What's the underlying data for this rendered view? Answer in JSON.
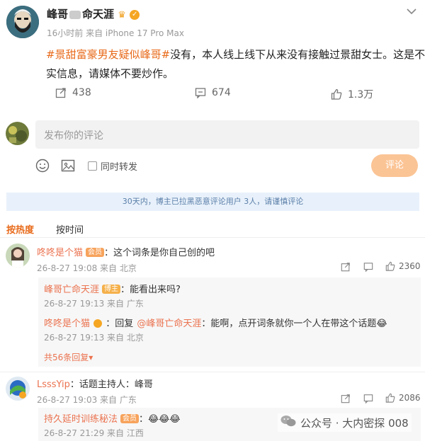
{
  "post": {
    "author": "峰哥",
    "author_suffix": "命天涯",
    "time_source": "16小时前  来自 iPhone 17 Pro Max",
    "hashtag": "#景甜富豪男友疑似峰哥#",
    "body_line1": "没有，本人线上线下从来没有接触过景甜女士。这是不",
    "body_line2": "实信息，请媒体不要炒作。",
    "reposts": "438",
    "comments": "674",
    "likes": "1.3万"
  },
  "composer": {
    "placeholder": "发布你的评论",
    "repost_label": "同时转发",
    "submit_label": "评论"
  },
  "notice": "30天内，博主已拉黑恶意评论用户 3人，请谨慎评论",
  "sort_tabs": {
    "hot": "按热度",
    "time": "按时间"
  },
  "comments": [
    {
      "name": "咚咚是个猫",
      "badge": "会员",
      "text": "：这个词条是你自己创的吧",
      "meta": "26-8-27 19:08 来自 北京",
      "likes": "2360",
      "replies": [
        {
          "name": "峰哥亡命天涯",
          "badge": "博主",
          "text": "：能看出来吗?",
          "meta": "26-8-27 19:13 来自 广东"
        },
        {
          "name": "咚咚是个猫",
          "badge": "",
          "text_prefix": "：回复",
          "mention": "@峰哥亡命天涯",
          "text": "：能啊，点开词条就你一个人在带这个话题😂",
          "meta": "26-8-27 19:13 来自 北京"
        }
      ],
      "more": "共56条回复▾"
    },
    {
      "name": "LsssYip",
      "badge": "",
      "text": "：话题主持人：峰哥",
      "meta": "26-8-27 19:03 来自 广东",
      "likes": "2086",
      "replies": [
        {
          "name": "持久延时训练秘法",
          "badge": "会员",
          "text": "：😂😂😂",
          "meta": "26-8-27 21:29 来自 江西"
        }
      ]
    }
  ],
  "watermark": "公众号 · 大内密探 008"
}
